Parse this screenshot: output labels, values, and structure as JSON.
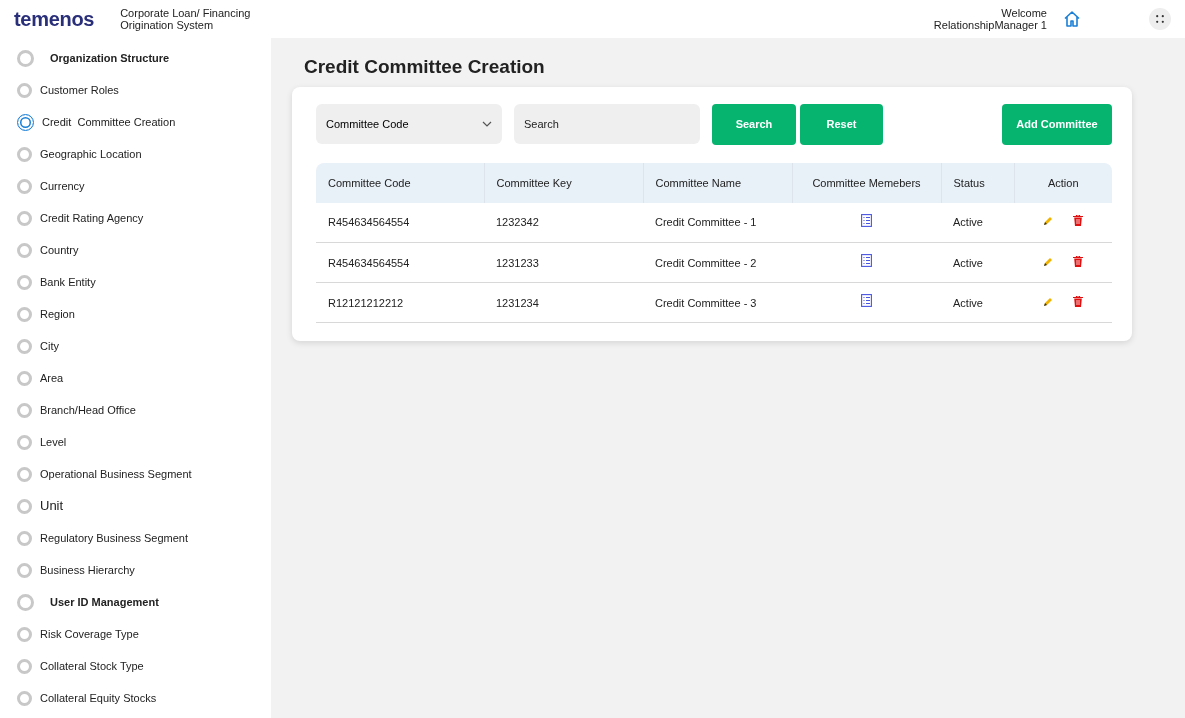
{
  "header": {
    "logo": "temenos",
    "app_title": [
      "Corporate Loan/ Financing",
      "Origination System"
    ],
    "welcome": "Welcome",
    "user": "RelationshipManager 1"
  },
  "sidebar": {
    "items": [
      {
        "label": "Organization Structure",
        "kind": "heading",
        "selected": false
      },
      {
        "label": "Customer Roles",
        "kind": "item",
        "selected": false
      },
      {
        "label": "Credit  Committee Creation",
        "kind": "item",
        "selected": true
      },
      {
        "label": "Geographic Location",
        "kind": "item",
        "selected": false
      },
      {
        "label": "Currency",
        "kind": "item",
        "selected": false
      },
      {
        "label": "Credit Rating Agency",
        "kind": "item",
        "selected": false
      },
      {
        "label": "Country",
        "kind": "item",
        "selected": false
      },
      {
        "label": "Bank Entity",
        "kind": "item",
        "selected": false
      },
      {
        "label": "Region",
        "kind": "item",
        "selected": false
      },
      {
        "label": "City",
        "kind": "item",
        "selected": false
      },
      {
        "label": "Area",
        "kind": "item",
        "selected": false
      },
      {
        "label": "Branch/Head Office",
        "kind": "item",
        "selected": false
      },
      {
        "label": "Level",
        "kind": "item",
        "selected": false
      },
      {
        "label": "Operational Business Segment",
        "kind": "item",
        "selected": false
      },
      {
        "label": "Unit",
        "kind": "large",
        "selected": false
      },
      {
        "label": "Regulatory Business Segment",
        "kind": "item",
        "selected": false
      },
      {
        "label": "Business Hierarchy",
        "kind": "item",
        "selected": false
      },
      {
        "label": "User ID Management",
        "kind": "heading",
        "selected": false
      },
      {
        "label": "Risk Coverage Type",
        "kind": "item",
        "selected": false
      },
      {
        "label": "Collateral Stock Type",
        "kind": "item",
        "selected": false
      },
      {
        "label": "Collateral Equity Stocks",
        "kind": "item",
        "selected": false
      }
    ]
  },
  "page_title": "Credit Committee Creation",
  "filters": {
    "dropdown": "Committee Code",
    "search_placeholder": "Search",
    "buttons": [
      "Search",
      "Reset"
    ],
    "add_button": "Add Committee"
  },
  "table": {
    "columns": [
      "Committee Code",
      "Committee Key",
      "Committee Name",
      "Committee Memebers",
      "Status",
      "Action"
    ],
    "rows": [
      {
        "code": "R454634564554",
        "key": "1232342",
        "name": "Credit Committee - 1",
        "status": "Active"
      },
      {
        "code": "R454634564554",
        "key": "1231233",
        "name": "Credit Committee - 2",
        "status": "Active"
      },
      {
        "code": "R12121212212",
        "key": "1231234",
        "name": "Credit Committee - 3",
        "status": "Active"
      }
    ]
  }
}
